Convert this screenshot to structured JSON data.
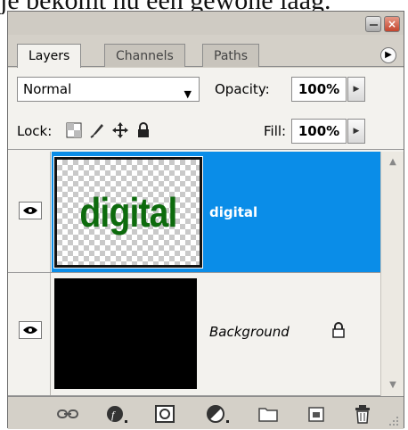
{
  "background_text": "je bekomt nu een gewone laag.",
  "panel": {
    "tabs": [
      {
        "label": "Layers",
        "active": true
      },
      {
        "label": "Channels",
        "active": false
      },
      {
        "label": "Paths",
        "active": false
      }
    ],
    "blend_mode": "Normal",
    "opacity_label": "Opacity:",
    "opacity_value": "100%",
    "lock_label": "Lock:",
    "fill_label": "Fill:",
    "fill_value": "100%"
  },
  "layers": [
    {
      "name": "digital",
      "thumbnail_text": "digital",
      "selected": true,
      "visible": true
    },
    {
      "name": "Background",
      "selected": false,
      "visible": true,
      "locked": true
    }
  ],
  "footer_icons": [
    "link-icon",
    "layer-style-icon",
    "layer-mask-icon",
    "adjustment-layer-icon",
    "new-group-icon",
    "new-layer-icon",
    "trash-icon"
  ],
  "colors": {
    "selection": "#0a8de8",
    "thumbnail_text": "#0d6b0d",
    "panel_bg": "#d4d0c8"
  }
}
